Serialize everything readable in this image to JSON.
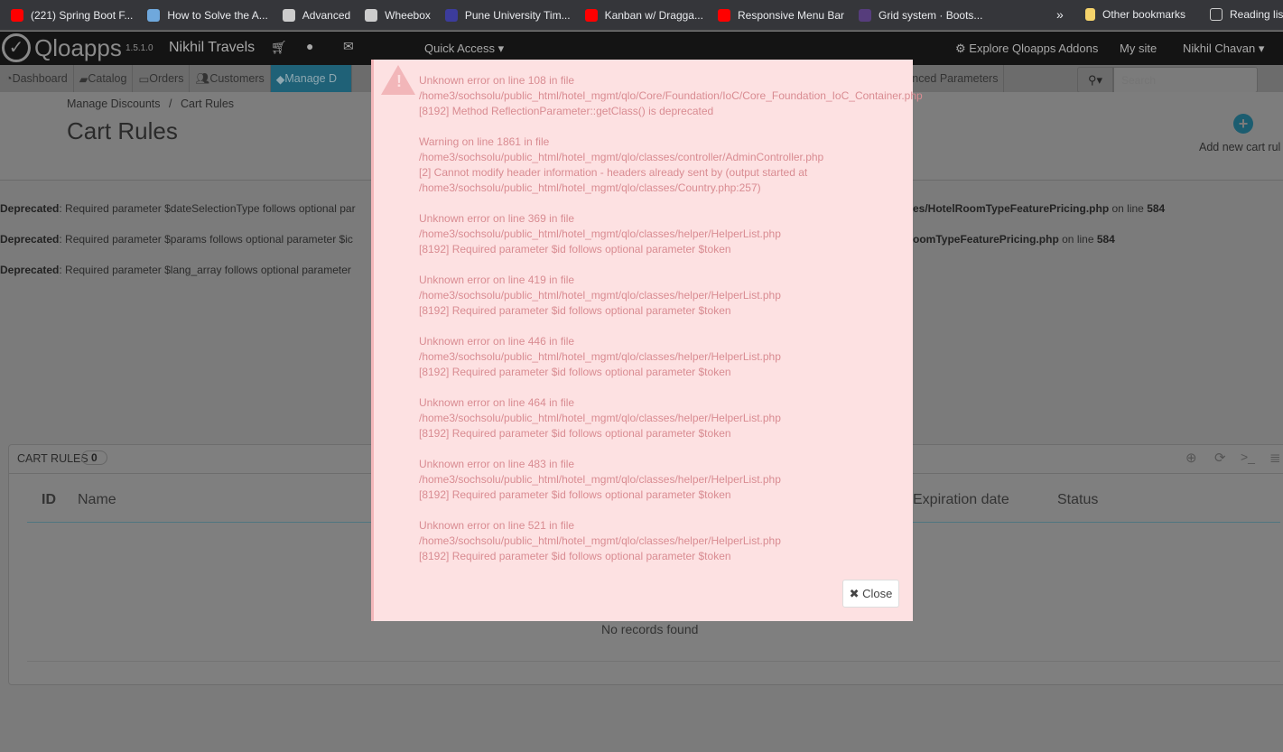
{
  "bookmarks": [
    {
      "label": "(221) Spring Boot F...",
      "icon": "youtube-icon",
      "color": "#ff0000"
    },
    {
      "label": "How to Solve the A...",
      "icon": "site-icon",
      "color": "#6fa8dc"
    },
    {
      "label": "Advanced",
      "icon": "globe-icon",
      "color": "#cccccc"
    },
    {
      "label": "Wheebox",
      "icon": "globe-icon",
      "color": "#cccccc"
    },
    {
      "label": "Pune University Tim...",
      "icon": "university-icon",
      "color": "#3c3c9c"
    },
    {
      "label": "Kanban w/ Dragga...",
      "icon": "youtube-icon",
      "color": "#ff0000"
    },
    {
      "label": "Responsive Menu Bar",
      "icon": "youtube-icon",
      "color": "#ff0000"
    },
    {
      "label": "Grid system · Boots...",
      "icon": "bootstrap-icon",
      "color": "#563d7c"
    }
  ],
  "bookmarks_more": "»",
  "other_bookmarks": "Other bookmarks",
  "reading_list": "Reading lis",
  "topbar": {
    "brand": "Qloapps",
    "version": "1.5.1.0",
    "shop": "Nikhil Travels",
    "quick_access": "Quick Access ▾",
    "explore": "Explore Qloapps Addons",
    "my_site": "My site",
    "user": "Nikhil Chavan ▾"
  },
  "tabs": [
    "Dashboard",
    "Catalog",
    "Orders",
    "Customers",
    "Manage D",
    "Advanced Parameters"
  ],
  "search": {
    "placeholder": "Search"
  },
  "breadcrumb": [
    "Manage Discounts",
    "Cart Rules"
  ],
  "breadcrumb_sep": "/",
  "page_title": "Cart Rules",
  "add_new": "Add new cart rul",
  "warnings": [
    {
      "label": "Deprecated",
      "text": ": Required parameter $dateSelectionType follows optional par",
      "tail_file": "es/HotelRoomTypeFeaturePricing.php",
      "tail_mid": " on line ",
      "tail_line": "584"
    },
    {
      "label": "Deprecated",
      "text": ": Required parameter $params follows optional parameter $ic",
      "tail_file": "oomTypeFeaturePricing.php",
      "tail_mid": " on line ",
      "tail_line": "584"
    },
    {
      "label": "Deprecated",
      "text": ": Required parameter $lang_array follows optional parameter",
      "tail_file": "",
      "tail_mid": "",
      "tail_line": ""
    }
  ],
  "panel": {
    "title": "CART RULES",
    "count": "0",
    "columns": [
      "ID",
      "Name",
      "Expiration date",
      "Status"
    ],
    "empty": "No records found"
  },
  "modal": {
    "errors": [
      [
        "Unknown error on line 108 in file",
        "/home3/sochsolu/public_html/hotel_mgmt/qlo/Core/Foundation/IoC/Core_Foundation_IoC_Container.php",
        "[8192] Method ReflectionParameter::getClass() is deprecated"
      ],
      [
        "Warning on line 1861 in file",
        "/home3/sochsolu/public_html/hotel_mgmt/qlo/classes/controller/AdminController.php",
        "[2] Cannot modify header information - headers already sent by (output started at",
        "/home3/sochsolu/public_html/hotel_mgmt/qlo/classes/Country.php:257)"
      ],
      [
        "Unknown error on line 369 in file",
        "/home3/sochsolu/public_html/hotel_mgmt/qlo/classes/helper/HelperList.php",
        "[8192] Required parameter $id follows optional parameter $token"
      ],
      [
        "Unknown error on line 419 in file",
        "/home3/sochsolu/public_html/hotel_mgmt/qlo/classes/helper/HelperList.php",
        "[8192] Required parameter $id follows optional parameter $token"
      ],
      [
        "Unknown error on line 446 in file",
        "/home3/sochsolu/public_html/hotel_mgmt/qlo/classes/helper/HelperList.php",
        "[8192] Required parameter $id follows optional parameter $token"
      ],
      [
        "Unknown error on line 464 in file",
        "/home3/sochsolu/public_html/hotel_mgmt/qlo/classes/helper/HelperList.php",
        "[8192] Required parameter $id follows optional parameter $token"
      ],
      [
        "Unknown error on line 483 in file",
        "/home3/sochsolu/public_html/hotel_mgmt/qlo/classes/helper/HelperList.php",
        "[8192] Required parameter $id follows optional parameter $token"
      ],
      [
        "Unknown error on line 521 in file",
        "/home3/sochsolu/public_html/hotel_mgmt/qlo/classes/helper/HelperList.php",
        "[8192] Required parameter $id follows optional parameter $token"
      ]
    ],
    "close": "Close"
  }
}
